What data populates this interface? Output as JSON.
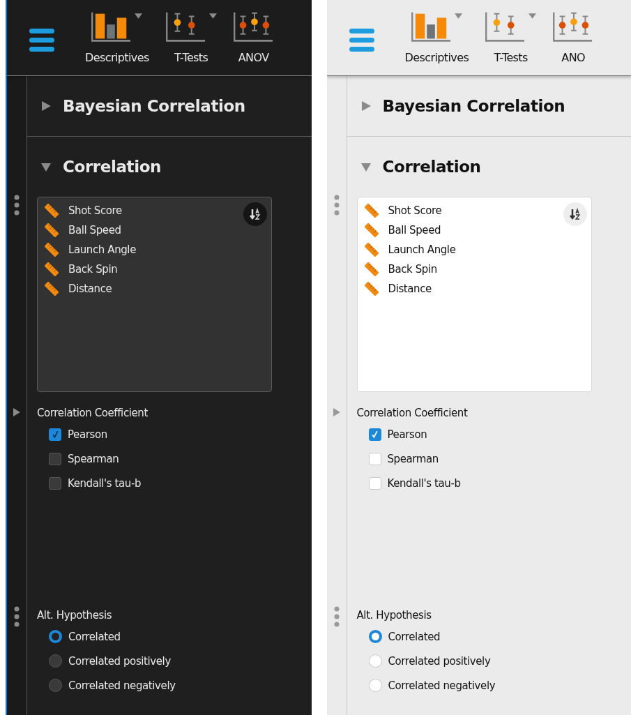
{
  "panels": [
    {
      "kind": "dark",
      "toolbar": [
        {
          "label": "Descriptives",
          "kind": "bars",
          "has_menu": true
        },
        {
          "label": "T-Tests",
          "kind": "errorbars",
          "has_menu": true
        },
        {
          "label": "ANOV",
          "kind": "errorbars3",
          "has_menu": false
        }
      ],
      "sections": [
        {
          "title": "Bayesian Correlation",
          "expanded": false
        },
        {
          "title": "Correlation",
          "expanded": true
        }
      ],
      "variables": [
        "Shot Score",
        "Ball Speed",
        "Launch Angle",
        "Back Spin",
        "Distance"
      ],
      "coefficient": {
        "label": "Correlation Coefficient",
        "options": [
          {
            "label": "Pearson",
            "checked": true
          },
          {
            "label": "Spearman",
            "checked": false
          },
          {
            "label": "Kendall's tau-b",
            "checked": false
          }
        ]
      },
      "hypothesis": {
        "label": "Alt. Hypothesis",
        "options": [
          {
            "label": "Correlated",
            "selected": true
          },
          {
            "label": "Correlated positively",
            "selected": false
          },
          {
            "label": "Correlated negatively",
            "selected": false
          }
        ]
      }
    },
    {
      "kind": "light",
      "toolbar": [
        {
          "label": "Descriptives",
          "kind": "bars",
          "has_menu": true
        },
        {
          "label": "T-Tests",
          "kind": "errorbars",
          "has_menu": true
        },
        {
          "label": "ANO",
          "kind": "errorbars3",
          "has_menu": false
        }
      ],
      "sections": [
        {
          "title": "Bayesian Correlation",
          "expanded": false
        },
        {
          "title": "Correlation",
          "expanded": true
        }
      ],
      "variables": [
        "Shot Score",
        "Ball Speed",
        "Launch Angle",
        "Back Spin",
        "Distance"
      ],
      "coefficient": {
        "label": "Correlation Coefficient",
        "options": [
          {
            "label": "Pearson",
            "checked": true
          },
          {
            "label": "Spearman",
            "checked": false
          },
          {
            "label": "Kendall's tau-b",
            "checked": false
          }
        ]
      },
      "hypothesis": {
        "label": "Alt. Hypothesis",
        "options": [
          {
            "label": "Correlated",
            "selected": true
          },
          {
            "label": "Correlated positively",
            "selected": false
          },
          {
            "label": "Correlated negatively",
            "selected": false
          }
        ]
      }
    }
  ]
}
